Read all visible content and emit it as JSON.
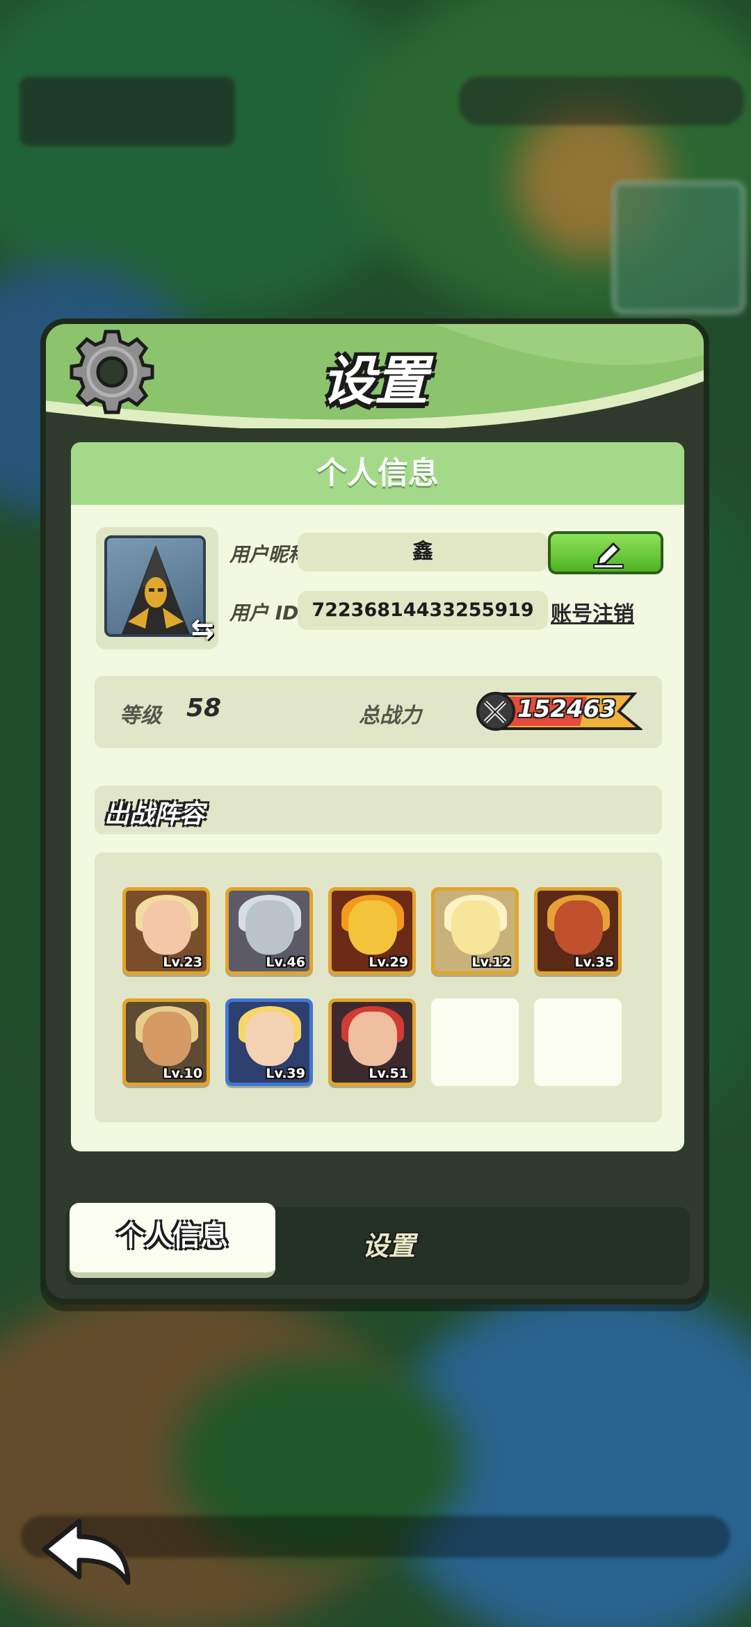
{
  "header": {
    "title": "设置",
    "icon": "gear-icon"
  },
  "profile": {
    "section_title": "个人信息",
    "nickname_label": "用户昵称",
    "nickname_value": "鑫",
    "id_label": "用户 ID",
    "id_value": "72236814433255919",
    "deregister_label": "账号注销",
    "edit_icon": "pencil-icon",
    "swap_icon": "swap-arrows-icon"
  },
  "stats": {
    "level_label": "等级",
    "level_value": "58",
    "power_label": "总战力",
    "power_value": "152463"
  },
  "lineup": {
    "title": "出战阵容",
    "heroes": [
      {
        "lv": "Lv.23"
      },
      {
        "lv": "Lv.46"
      },
      {
        "lv": "Lv.29"
      },
      {
        "lv": "Lv.12"
      },
      {
        "lv": "Lv.35"
      },
      {
        "lv": "Lv.10"
      },
      {
        "lv": "Lv.39"
      },
      {
        "lv": "Lv.51"
      }
    ]
  },
  "tabs": {
    "active": "个人信息",
    "inactive": "设置"
  },
  "colors": {
    "header_green": "#8cc46e",
    "card_bg": "#f3f8e0",
    "edit_green": "#5cc22e",
    "frame_orange": "#e3a32b",
    "frame_blue": "#3f77d6"
  }
}
